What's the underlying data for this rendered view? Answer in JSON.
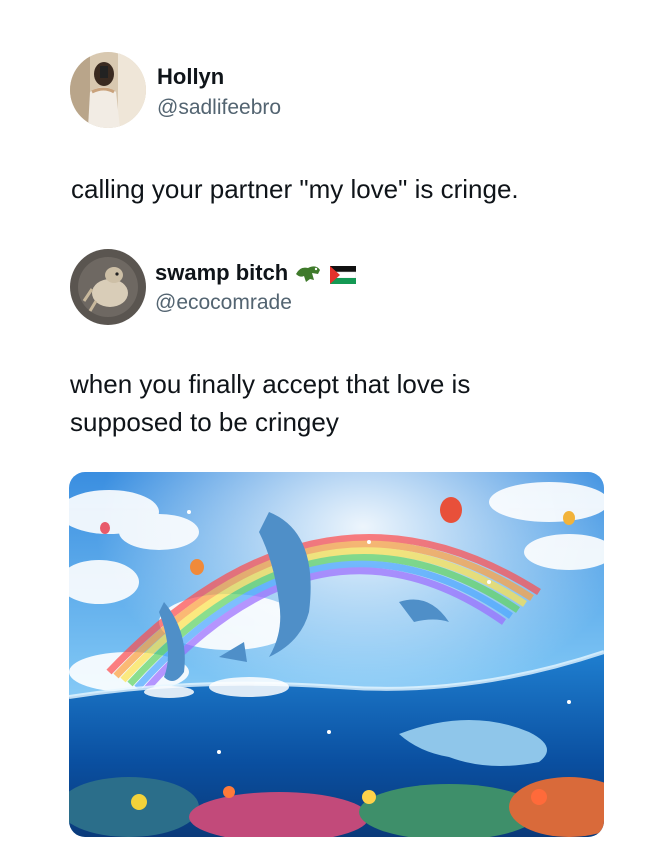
{
  "tweet1": {
    "display_name": "Hollyn",
    "handle": "@sadlifeebro",
    "text": "calling your partner \"my love\" is cringe."
  },
  "tweet2": {
    "display_name": "swamp bitch",
    "name_emojis": [
      "crocodile-emoji",
      "palestine-flag-emoji"
    ],
    "handle": "@ecocomrade",
    "text_line1": "when you finally accept that love is",
    "text_line2": "supposed to be cringey"
  },
  "colors": {
    "text": "#0f1419",
    "handle": "#536471",
    "background": "#ffffff"
  }
}
